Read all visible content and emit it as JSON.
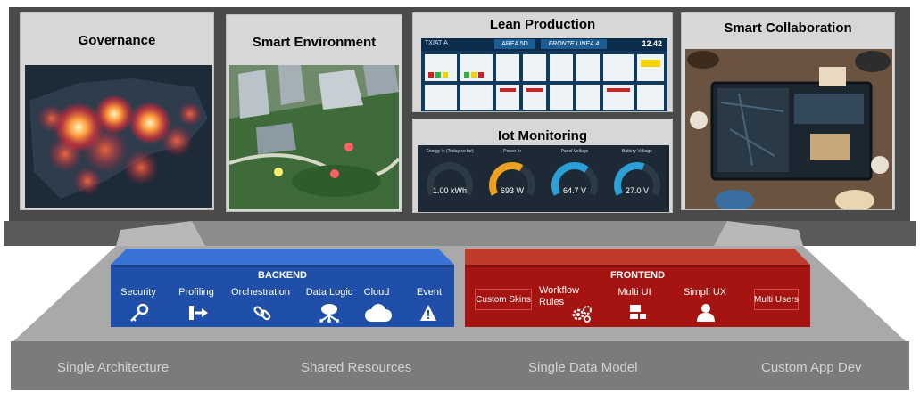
{
  "panels": {
    "governance": {
      "title": "Governance"
    },
    "smart_environment": {
      "title": "Smart Environment"
    },
    "lean_production": {
      "title": "Lean Production",
      "screen": {
        "brand": "TXIATIA",
        "area": "AREA 5D",
        "line": "FRONTE LINEA 4",
        "time": "12.42"
      }
    },
    "iot_monitoring": {
      "title": "Iot Monitoring",
      "gauges": [
        {
          "label": "Energy in (Today so far)",
          "value": "1.00 kWh",
          "level": 0.0,
          "color": "#2a2a2a"
        },
        {
          "label": "Power In",
          "value": "693 W",
          "level": 0.62,
          "color": "#f0a020"
        },
        {
          "label": "Panel Voltage",
          "value": "64.7 V",
          "level": 0.66,
          "color": "#2a9fd8"
        },
        {
          "label": "Battery Voltage",
          "value": "27.0 V",
          "level": 0.58,
          "color": "#2a9fd8"
        }
      ]
    },
    "smart_collaboration": {
      "title": "Smart Collaboration"
    }
  },
  "backend": {
    "title": "BACKEND",
    "color": "#1f4fa8",
    "items": [
      {
        "label": "Security",
        "icon": "key-icon"
      },
      {
        "label": "Profiling",
        "icon": "login-icon"
      },
      {
        "label": "Orchestration",
        "icon": "link-icon"
      },
      {
        "label": "Data Logic",
        "icon": "network-icon"
      },
      {
        "label": "Cloud",
        "icon": "cloud-icon"
      },
      {
        "label": "Event",
        "icon": "warning-icon"
      }
    ]
  },
  "frontend": {
    "title": "FRONTEND",
    "color": "#a51410",
    "custom_skins": "Custom Skins",
    "workflow_rules": "Workflow Rules",
    "multi_ui": "Multi UI",
    "simpli_ux": "Simpli UX",
    "multi_users": "Multi Users"
  },
  "footer": [
    "Single Architecture",
    "Shared Resources",
    "Single Data Model",
    "Custom App Dev"
  ]
}
